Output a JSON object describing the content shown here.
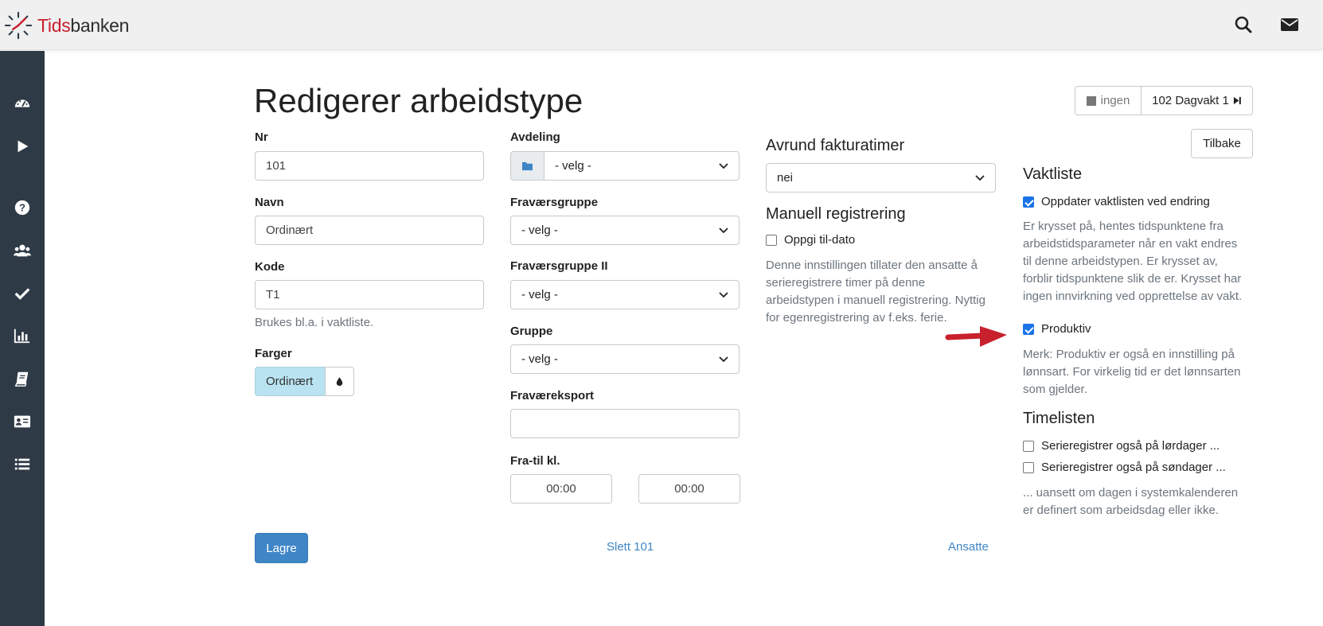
{
  "app": {
    "logo_prefix": "Tids",
    "logo_suffix": "banken"
  },
  "header": {
    "icons": [
      "search-icon",
      "envelope-icon"
    ]
  },
  "sidebar": {
    "icons": [
      "dashboard-icon",
      "play-icon",
      "question-icon",
      "users-icon",
      "check-icon",
      "bar-chart-icon",
      "book-icon",
      "id-card-icon",
      "list-icon"
    ]
  },
  "page": {
    "title": "Redigerer arbeidstype"
  },
  "nav": {
    "none_label": "ingen",
    "next_label": "102 Dagvakt 1",
    "back_label": "Tilbake"
  },
  "col1": {
    "nr_label": "Nr",
    "nr_value": "101",
    "navn_label": "Navn",
    "navn_value": "Ordinært",
    "kode_label": "Kode",
    "kode_value": "T1",
    "kode_help": "Brukes bl.a. i vaktliste.",
    "farger_label": "Farger",
    "farger_value": "Ordinært",
    "farger_color": "#b9e3f1"
  },
  "col2": {
    "avdeling_label": "Avdeling",
    "avdeling_value": "- velg -",
    "fravaersgruppe_label": "Fraværsgruppe",
    "fravaersgruppe_value": "- velg -",
    "fravaersgruppe2_label": "Fraværsgruppe II",
    "fravaersgruppe2_value": "- velg -",
    "gruppe_label": "Gruppe",
    "gruppe_value": "- velg -",
    "fravaereksport_label": "Fraværeksport",
    "fravaereksport_value": "",
    "fratil_label": "Fra-til kl.",
    "fra_value": "00:00",
    "til_value": "00:00"
  },
  "col3": {
    "avrund_title": "Avrund fakturatimer",
    "avrund_value": "nei",
    "manuell_title": "Manuell registrering",
    "oppgi_label": "Oppgi til-dato",
    "manuell_help_1": "Denne innstillingen tillater den ansatte å",
    "manuell_help_2": "serieregistrere timer på denne",
    "manuell_help_3": "arbeidstypen i manuell registrering. Nyttig",
    "manuell_help_4": "for egenregistrering av f.eks. ferie."
  },
  "col4": {
    "vaktliste_title": "Vaktliste",
    "oppdater_label": "Oppdater vaktlisten ved endring",
    "vakt_help_1": "Er krysset på, hentes tidspunktene fra",
    "vakt_help_2": "arbeidstidsparameter når en vakt endres",
    "vakt_help_3": "til denne arbeidstypen. Er krysset av,",
    "vakt_help_4": "forblir tidspunktene slik de er. Krysset har",
    "vakt_help_5": "ingen innvirkning ved opprettelse av vakt.",
    "produktiv_label": "Produktiv",
    "prod_help_1": "Merk: Produktiv er også en innstilling på",
    "prod_help_2": "lønnsart. For virkelig tid er det lønnsarten",
    "prod_help_3": "som gjelder.",
    "timelisten_title": "Timelisten",
    "lor_label": "Serieregistrer også på lørdager ...",
    "son_label": "Serieregistrer også på søndager ...",
    "time_help_1": "... uansett om dagen i systemkalenderen",
    "time_help_2": "er definert som arbeidsdag eller ikke."
  },
  "footer": {
    "save_label": "Lagre",
    "delete_label": "Slett 101",
    "employees_label": "Ansatte"
  },
  "colors": {
    "primary": "#3f86c7",
    "sidebar": "#2e3a46",
    "arrow": "#c8202d"
  }
}
